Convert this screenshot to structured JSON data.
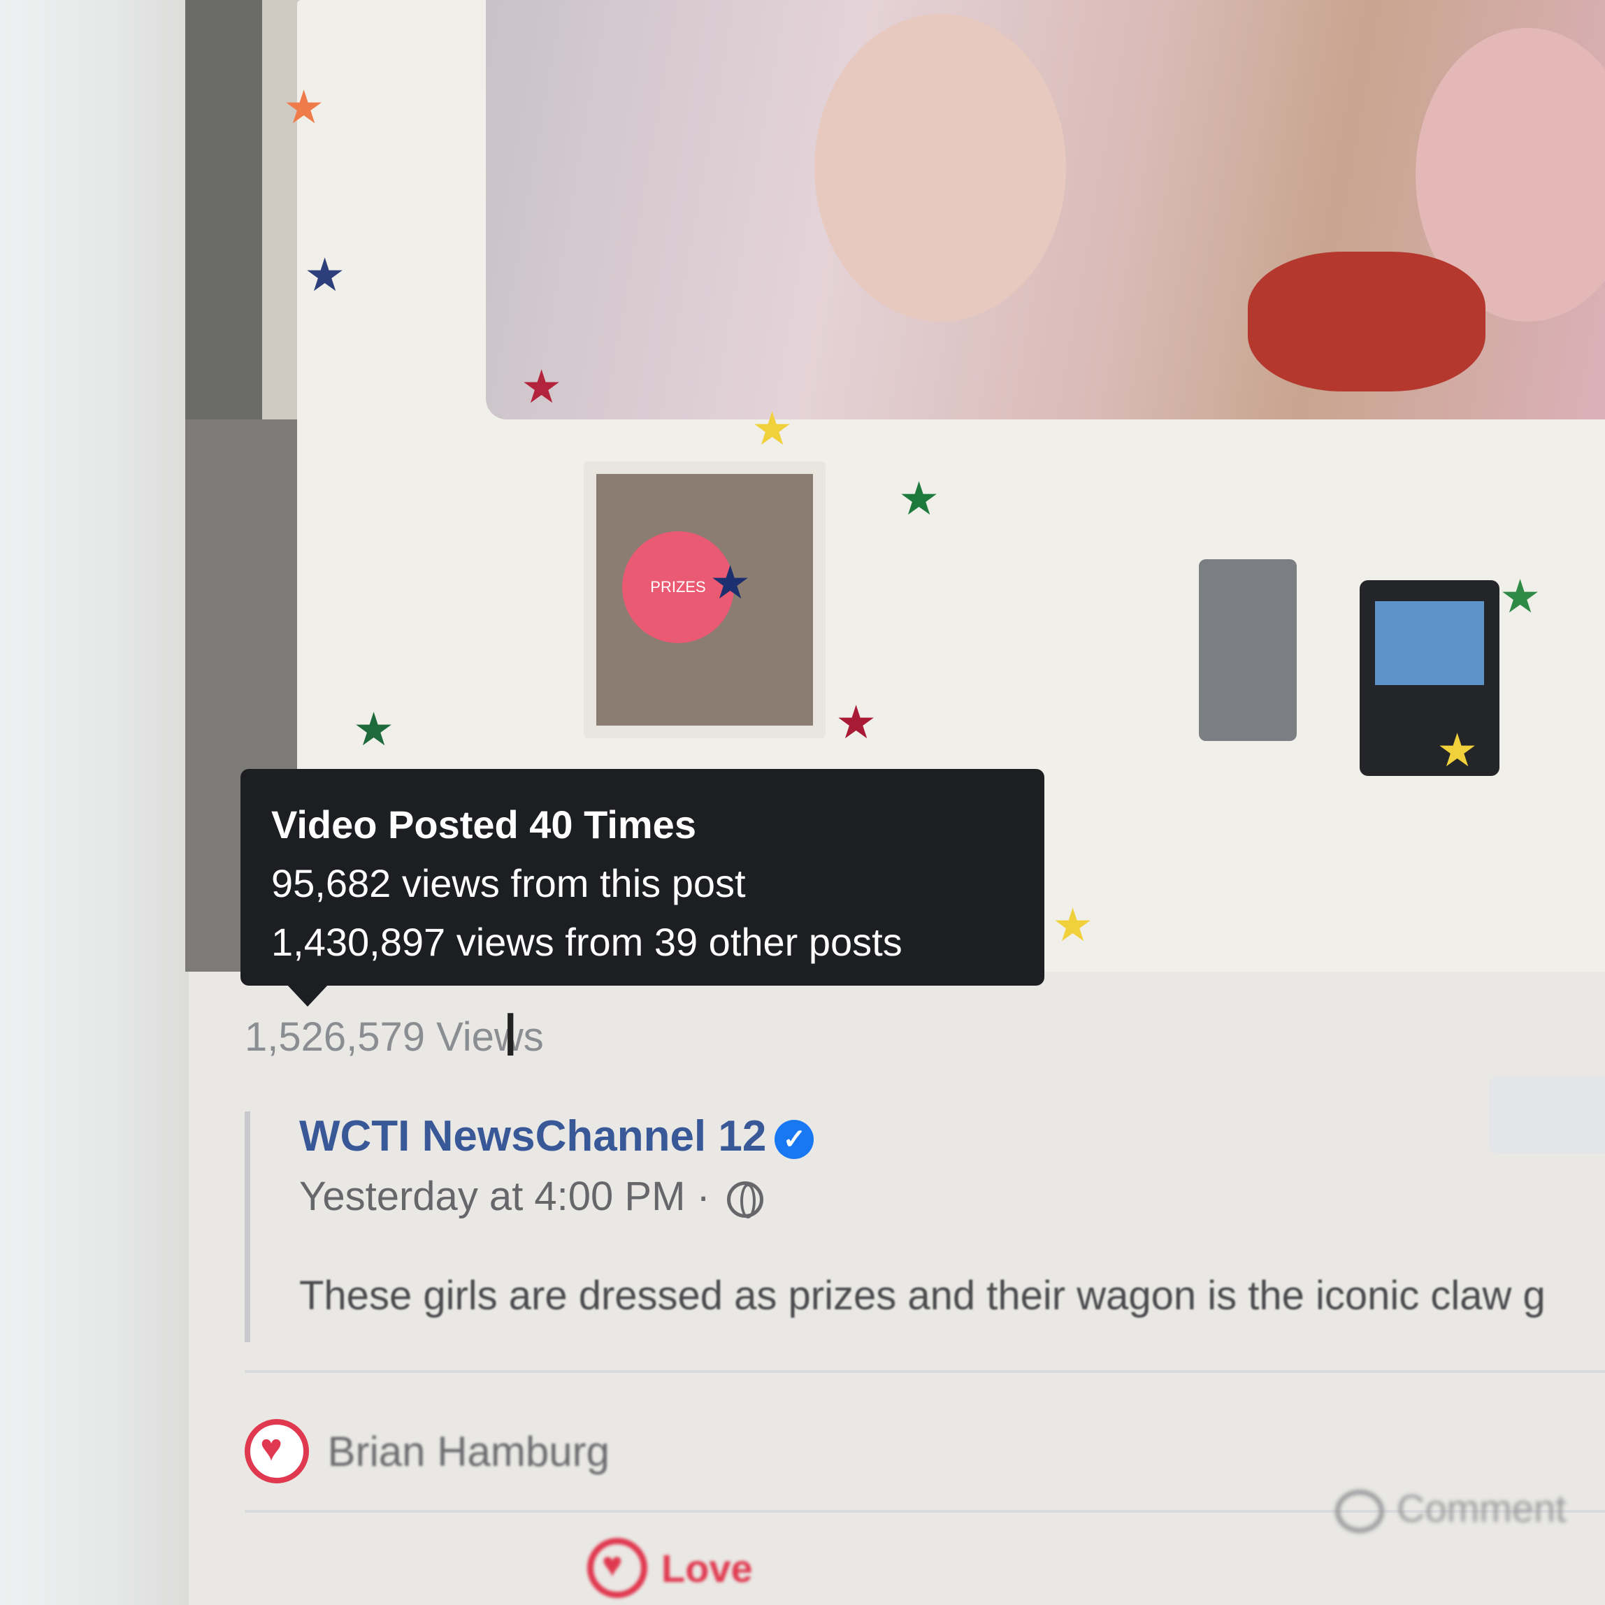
{
  "video": {
    "badge_text": "PRIZES"
  },
  "tooltip": {
    "title": "Video Posted 40 Times",
    "this_post": "95,682 views from this post",
    "other_posts": "1,430,897 views from 39 other posts"
  },
  "views": {
    "total": "1,526,579 Views"
  },
  "post": {
    "author": "WCTI NewsChannel 12",
    "verified_icon": "verified-check-icon",
    "time": "Yesterday at 4:00 PM ·",
    "privacy_icon": "globe-icon",
    "text": "These girls are dressed as prizes and their wagon is the iconic claw g"
  },
  "reactions": {
    "user": "Brian Hamburg",
    "reaction_icon": "love-heart-icon"
  },
  "actions": {
    "love_label": "Love",
    "comment_label": "Comment"
  },
  "colors": {
    "tooltip_bg": "#1c1e21",
    "author_link": "#385898",
    "verified": "#1877f2",
    "love": "#e0384f",
    "muted_text": "#65676b"
  }
}
